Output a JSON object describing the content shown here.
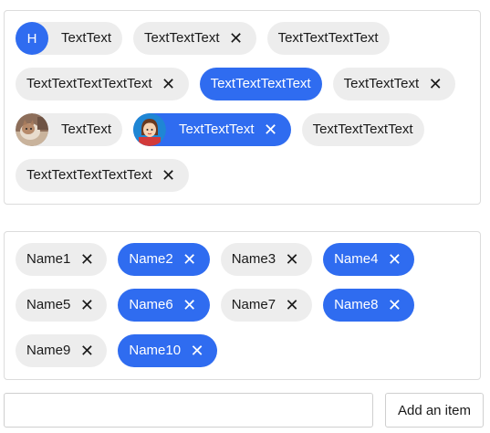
{
  "top_chips": [
    {
      "label": "TextText",
      "avatar": {
        "type": "letter",
        "text": "H"
      },
      "selected": false,
      "closable": false
    },
    {
      "label": "TextTextText",
      "selected": false,
      "closable": true
    },
    {
      "label": "TextTextTextText",
      "selected": false,
      "closable": false
    },
    {
      "label": "TextTextTextTextText",
      "selected": false,
      "closable": true
    },
    {
      "label": "TextTextTextText",
      "selected": true,
      "closable": false
    },
    {
      "label": "TextTextText",
      "selected": false,
      "closable": true
    },
    {
      "label": "TextText",
      "avatar": {
        "type": "photo-cat"
      },
      "selected": false,
      "closable": false
    },
    {
      "label": "TextTextText",
      "avatar": {
        "type": "cartoon-person"
      },
      "selected": true,
      "closable": true
    },
    {
      "label": "TextTextTextText",
      "selected": false,
      "closable": false
    },
    {
      "label": "TextTextTextTextText",
      "selected": false,
      "closable": true
    }
  ],
  "name_chips": [
    {
      "label": "Name1",
      "selected": false
    },
    {
      "label": "Name2",
      "selected": true
    },
    {
      "label": "Name3",
      "selected": false
    },
    {
      "label": "Name4",
      "selected": true
    },
    {
      "label": "Name5",
      "selected": false
    },
    {
      "label": "Name6",
      "selected": true
    },
    {
      "label": "Name7",
      "selected": false
    },
    {
      "label": "Name8",
      "selected": true
    },
    {
      "label": "Name9",
      "selected": false
    },
    {
      "label": "Name10",
      "selected": true
    }
  ],
  "close_glyph": "✕",
  "input": {
    "value": "",
    "placeholder": ""
  },
  "add_button_label": "Add an item",
  "colors": {
    "accent": "#2f6cf0",
    "chip_bg": "#ededed"
  }
}
